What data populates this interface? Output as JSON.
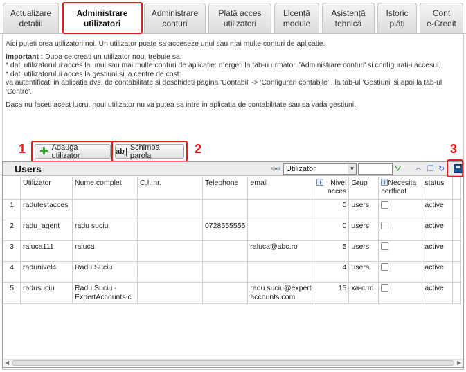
{
  "tabs": [
    {
      "label": "Actualizare\ndetaliii"
    },
    {
      "label": "Administrare\nutilizatori"
    },
    {
      "label": "Administrare\nconturi"
    },
    {
      "label": "Plată acces\nutilizatori"
    },
    {
      "label": "Licență\nmodule"
    },
    {
      "label": "Asistență\ntehnică"
    },
    {
      "label": "Istoric\nplăți"
    },
    {
      "label": "Cont\ne-Credit"
    }
  ],
  "intro": {
    "line1": "Aici puteti crea utilizatori noi. Un utilizator poate sa acceseze unul sau mai multe conturi de aplicatie.",
    "important_label": "Important :",
    "important_text": " Dupa ce creati un utilizator nou, trebuie sa:",
    "bullet1": "* dati utilizatorului acces la unul sau mai multe conturi de aplicatie: mergeti la tab-u urmator, 'Administrare conturi' si configurati-i accesul.",
    "bullet2": "* dati utilizatorului acces la gestiuni si la centre de cost:",
    "bullet2b": "va autentificati in aplicatia dvs. de contabilitate si deschideti pagina 'Contabil' -> 'Configurari contabile' , la tab-ul 'Gestiuni' si apoi la tab-ul 'Centre'.",
    "warning": "Daca nu faceti acest lucru, noul utilizator nu va putea sa intre in aplicatia de contabilitate sau sa vada gestiuni."
  },
  "buttons": {
    "add_user": "Adauga utilizator",
    "change_password": "Schimba parola",
    "ab_glyph": "ab"
  },
  "annotations": {
    "n1": "1",
    "n2": "2",
    "n3": "3"
  },
  "grid": {
    "title": "Users",
    "search_field": "Utilizator",
    "search_value": "",
    "columns": [
      "",
      "Utilizator",
      "Nume complet",
      "C.I. nr.",
      "Telephone",
      "email",
      "Nivel acces",
      "Grup",
      "Necesita certficat",
      "status"
    ],
    "rows": [
      {
        "idx": "1",
        "user": "radutestacces",
        "name": "",
        "ci": "",
        "phone": "",
        "email": "",
        "level": "0",
        "group": "users",
        "status": "active"
      },
      {
        "idx": "2",
        "user": "radu_agent",
        "name": "radu suciu",
        "ci": "",
        "phone": "0728555555",
        "email": "",
        "level": "0",
        "group": "users",
        "status": "active"
      },
      {
        "idx": "3",
        "user": "raluca111",
        "name": "raluca",
        "ci": "",
        "phone": "",
        "email": "raluca@abc.ro",
        "level": "5",
        "group": "users",
        "status": "active"
      },
      {
        "idx": "4",
        "user": "radunivel4",
        "name": "Radu Suciu",
        "ci": "",
        "phone": "",
        "email": "",
        "level": "4",
        "group": "users",
        "status": "active"
      },
      {
        "idx": "5",
        "user": "radusuciu",
        "name": "Radu Suciu - ExpertAccounts.c",
        "ci": "",
        "phone": "",
        "email": "radu.suciu@expertaccounts.com",
        "level": "15",
        "group": "xa-crm",
        "status": "active"
      }
    ]
  },
  "colors": {
    "highlight": "#e31d1d"
  }
}
